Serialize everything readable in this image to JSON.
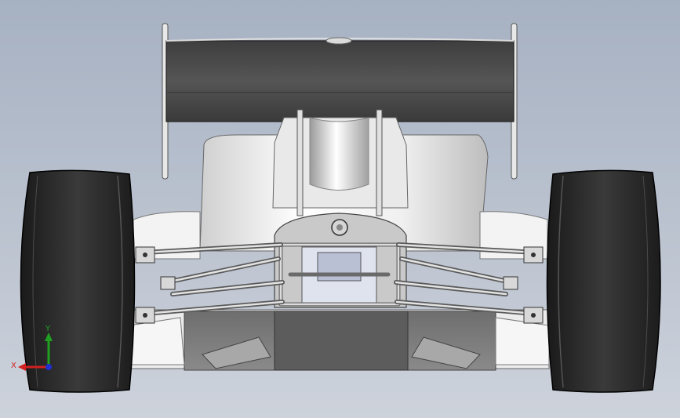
{
  "viewport": {
    "background_top": "#a9b3c3",
    "background_bottom": "#c8ced8"
  },
  "model": {
    "body_color": "#f2f2f2",
    "wing_color": "#4a4a4a",
    "tire_color": "#2b2b2b",
    "frame_color": "#cfcfcf"
  },
  "triad": {
    "x_label": "X",
    "y_label": "Y",
    "x_color": "#d02020",
    "y_color": "#20a020",
    "z_color": "#2030d0"
  }
}
